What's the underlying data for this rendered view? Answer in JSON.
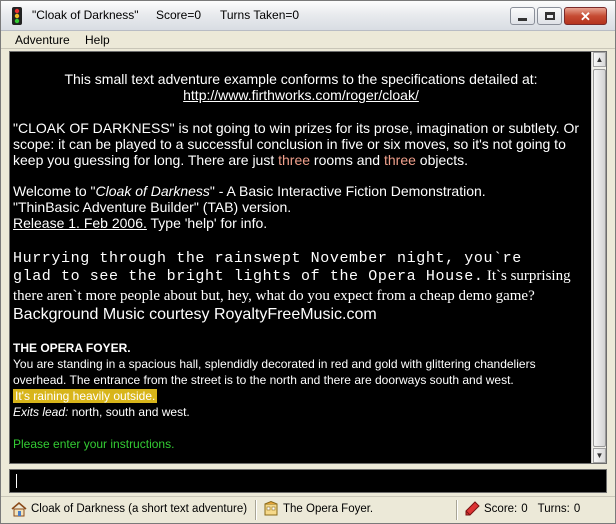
{
  "window": {
    "title": "\"Cloak of Darkness\"",
    "score_label": "Score=0",
    "turns_label": "Turns Taken=0"
  },
  "menu": {
    "items": [
      {
        "label": "Adventure"
      },
      {
        "label": "Help"
      }
    ]
  },
  "output": {
    "intro_line": "This small text adventure example conforms to the specifications detailed at:",
    "intro_link": "http://www.firthworks.com/roger/cloak/",
    "para1_line1": "\"CLOAK OF DARKNESS\" is not going to win prizes for its prose, imagination or subtlety. Or",
    "para1_line2": "scope: it can be played to a successful conclusion in five or six moves, so it's not going to",
    "para1_line3_a": "keep you guessing for long. There are just ",
    "para1_line3_b": "three",
    "para1_line3_c": " rooms and ",
    "para1_line3_d": "three",
    "para1_line3_e": " objects.",
    "welcome_a": "Welcome to \"",
    "welcome_b": "Cloak of Darkness",
    "welcome_c": "\" - A Basic Interactive Fiction Demonstration.",
    "builder_line": "\"ThinBasic Adventure Builder\" (TAB) version.",
    "release_a": "Release 1. Feb 2006.",
    "release_b": " Type 'help' for info.",
    "mono_line1": "Hurrying through the rainswept November night, you`re",
    "mono_line2": "glad to see the bright lights of the Opera House.",
    "serif_line1_tail": "It`s surprising",
    "serif_line2": "there aren`t more people about but, hey, what do you expect from a cheap demo game?",
    "music_line": "Background Music courtesy RoyaltyFreeMusic.com",
    "room_title": "THE OPERA FOYER.",
    "room_desc1": "You are standing in a spacious hall, splendidly decorated in red and gold with glittering chandeliers",
    "room_desc2": "overhead. The entrance from the street is to the north and there are doorways south and west.",
    "weather": "It's raining heavily outside.",
    "exits_label": "Exits lead:",
    "exits_value": " north, south and west.",
    "prompt": "Please enter your instructions."
  },
  "input": {
    "value": ""
  },
  "statusbar": {
    "game_name": "Cloak of Darkness (a short text adventure)",
    "room": "The Opera Foyer.",
    "score_label": "Score:",
    "score_value": "0",
    "turns_label": "Turns:",
    "turns_value": "0"
  },
  "colors": {
    "highlight_pink": "#f0a08c",
    "weather_highlight": "#d8b51a",
    "prompt_green": "#33cc33",
    "output_bg": "#000000"
  },
  "icons": {
    "app": "traffic-light-icon",
    "home": "home-icon",
    "room": "room-icon",
    "score": "pencil-icon"
  }
}
